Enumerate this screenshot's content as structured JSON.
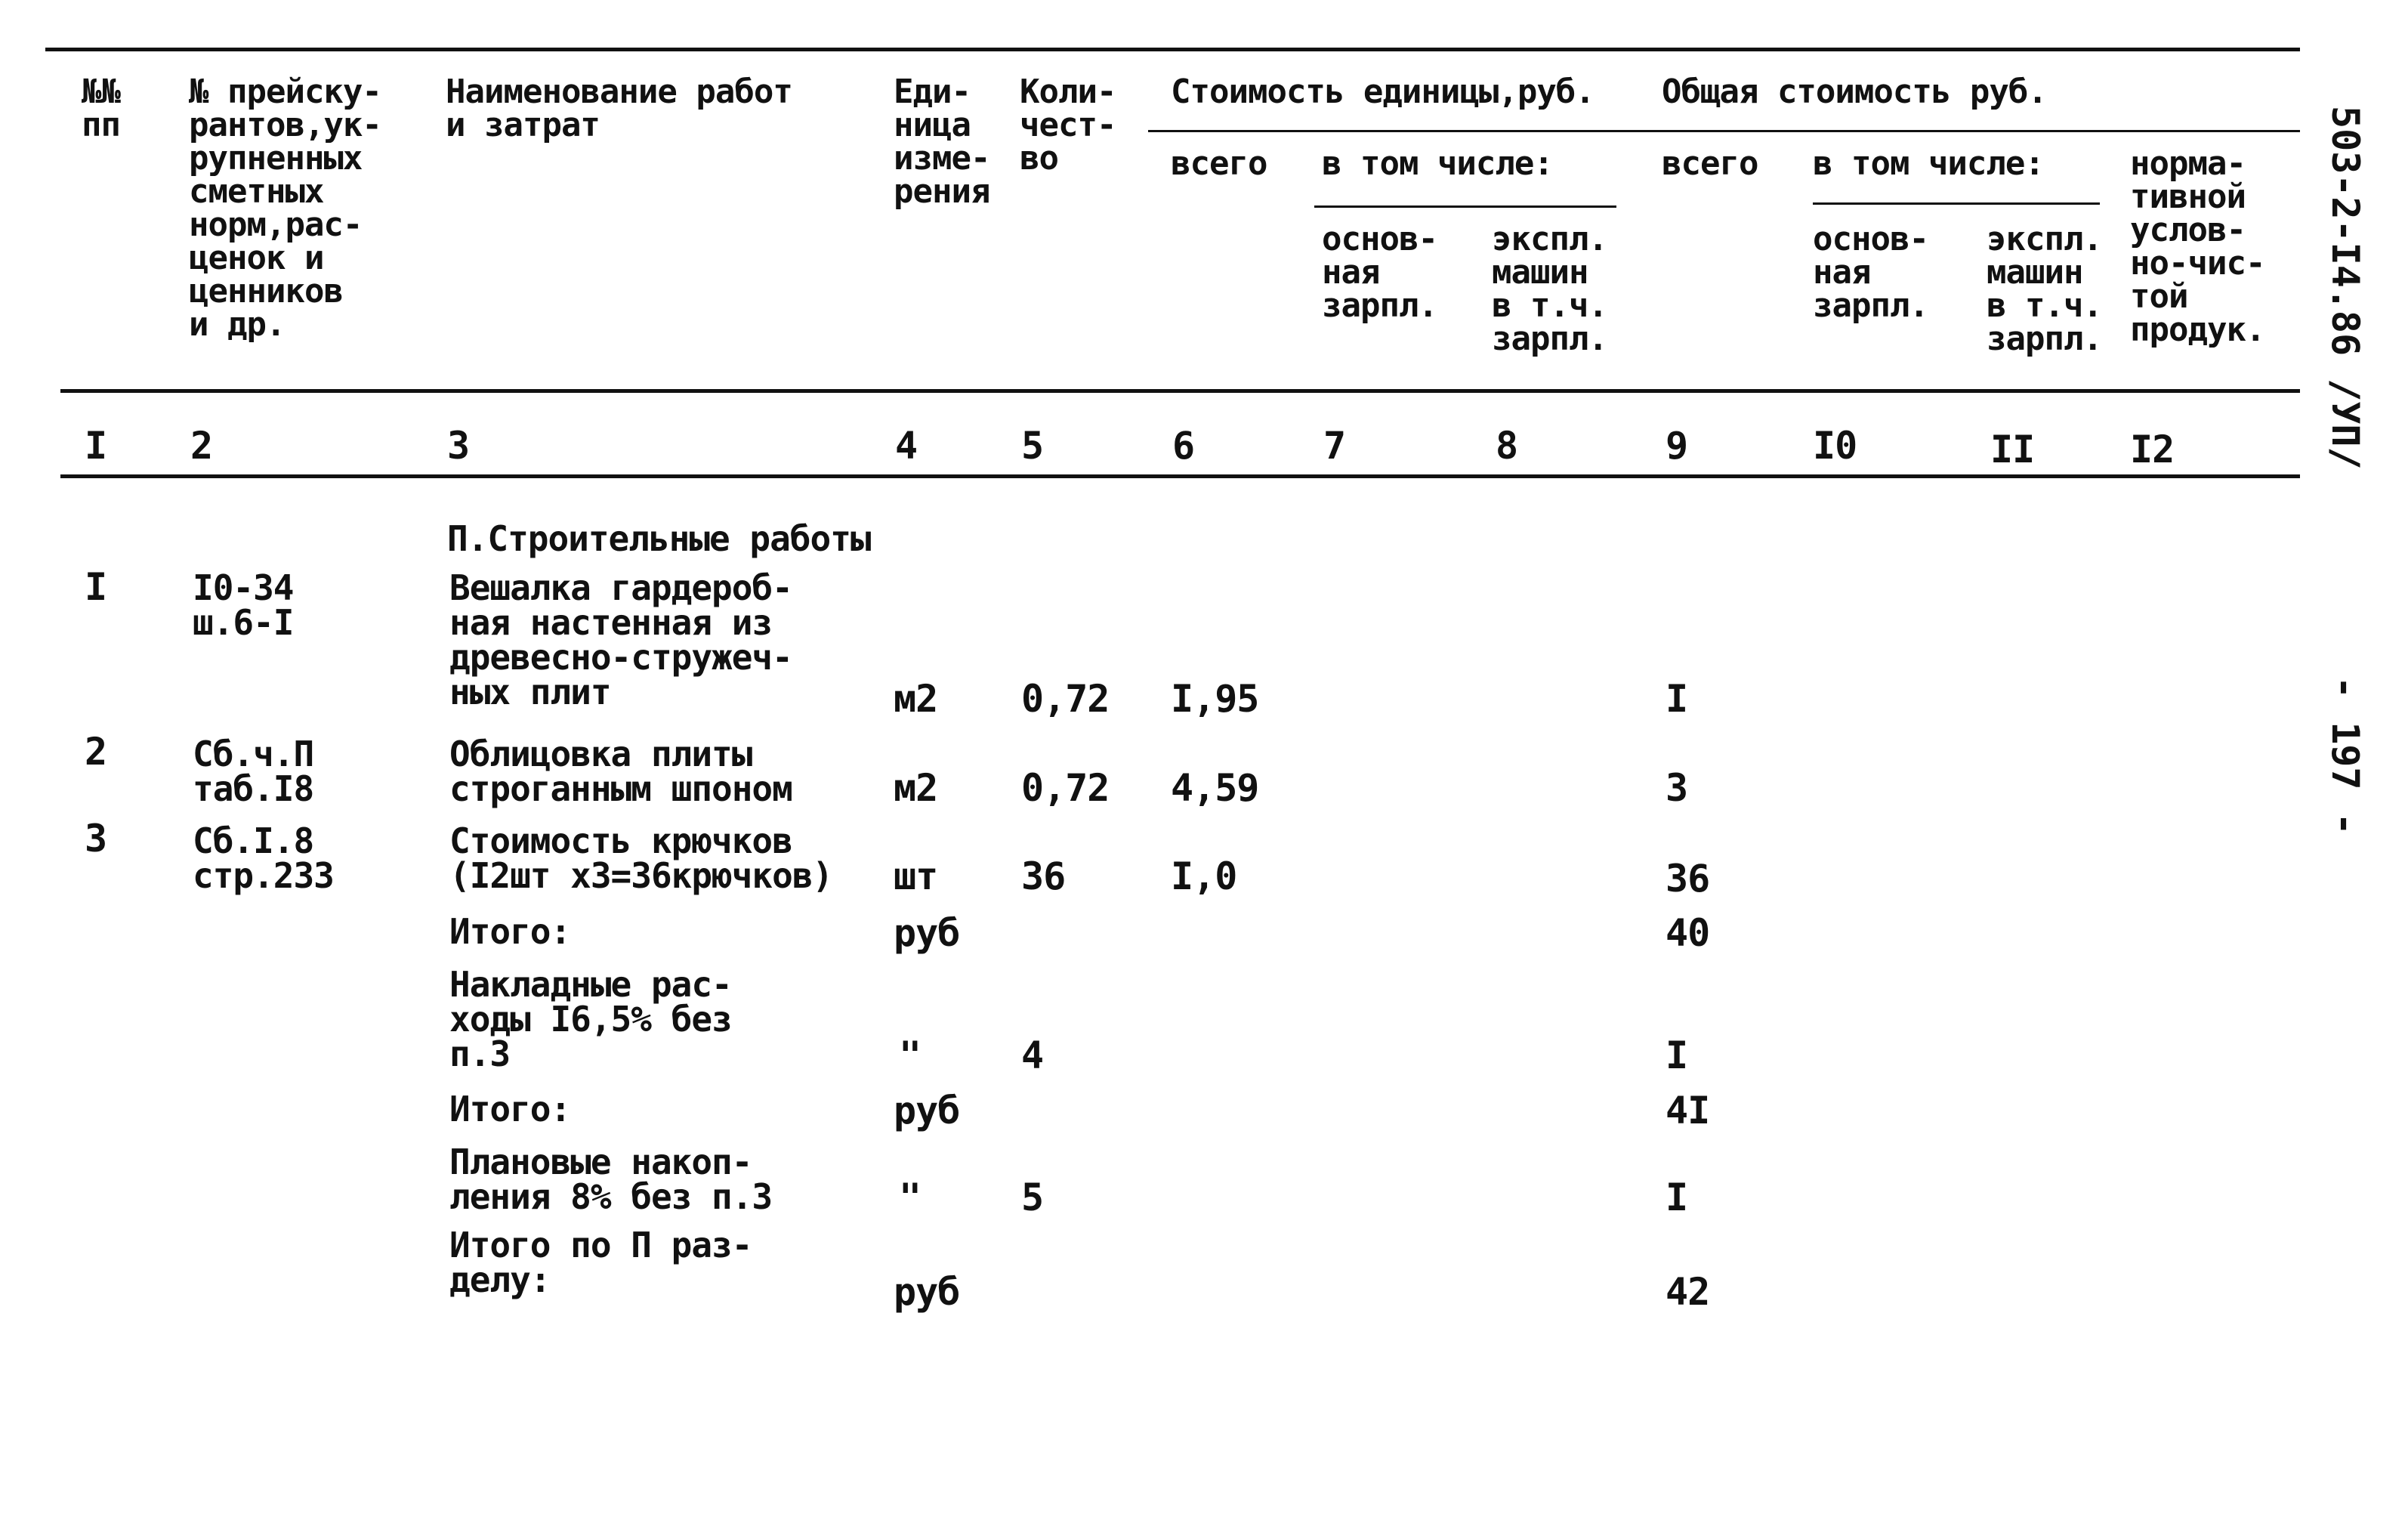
{
  "header": {
    "col1": "№№\nпп",
    "col2": "№ прейску-\nрантов,ук-\nрупненных\nсметных\nнорм,рас-\nценок и\nценников\nи др.",
    "col3": "Наименование работ\nи затрат",
    "col4": "Еди-\nница\nизме-\nрения",
    "col5": "Коли-\nчест-\nво",
    "unit_cost_group": "Стоимость единицы,руб.",
    "total_cost_group": "Общая стоимость руб.",
    "unit_total": "всего",
    "unit_incl": "в том числе:",
    "unit_wages": "основ-\nная\nзарпл.",
    "unit_machines": "экспл.\nмашин\nв т.ч.\nзарпл.",
    "total_total": "всего",
    "total_incl": "в том числе:",
    "total_wages": "основ-\nная\nзарпл.",
    "total_machines": "экспл.\nмашин\nв т.ч.\nзарпл.",
    "normative": "норма-\nтивной\nуслов-\nно-чис-\nтой\nпродук."
  },
  "column_numbers": [
    "I",
    "2",
    "3",
    "4",
    "5",
    "6",
    "7",
    "8",
    "9",
    "I0",
    "II",
    "I2"
  ],
  "section_title": "П.Строительные работы",
  "rows": [
    {
      "no": "I",
      "ref": "I0-34\nш.6-I",
      "name": "Вешалка гардероб-\nная настенная из\nдревесно-стружеч-\nных плит",
      "unit": "м2",
      "qty": "0,72",
      "unit_cost": "I,95",
      "total": "I"
    },
    {
      "no": "2",
      "ref": "Сб.ч.П\nтаб.I8",
      "name": "Облицовка плиты\nстроганным шпоном",
      "unit": "м2",
      "qty": "0,72",
      "unit_cost": "4,59",
      "total": "3"
    },
    {
      "no": "3",
      "ref": "Сб.I.8\nстр.233",
      "name": "Стоимость крючков\n(I2шт х3=36крючков)",
      "unit": "шт",
      "qty": "36",
      "unit_cost": "I,0",
      "total": "36"
    },
    {
      "no": "",
      "ref": "",
      "name": "Итого:",
      "unit": "руб",
      "qty": "",
      "unit_cost": "",
      "total": "40"
    },
    {
      "no": "",
      "ref": "",
      "name": "Накладные рас-\nходы I6,5% без\nп.3",
      "unit": "\"",
      "qty": "4",
      "unit_cost": "",
      "total": "I"
    },
    {
      "no": "",
      "ref": "",
      "name": "Итого:",
      "unit": "руб",
      "qty": "",
      "unit_cost": "",
      "total": "4I"
    },
    {
      "no": "",
      "ref": "",
      "name": "Плановые накоп-\nления 8% без п.3",
      "unit": "\"",
      "qty": "5",
      "unit_cost": "",
      "total": "I"
    },
    {
      "no": "",
      "ref": "",
      "name": "Итого по П раз-\nделу:",
      "unit": "руб",
      "qty": "",
      "unit_cost": "",
      "total": "42"
    }
  ],
  "margin": {
    "doc_code": "503-2-I4.86 /УП/",
    "page_number": "- 197 -"
  }
}
